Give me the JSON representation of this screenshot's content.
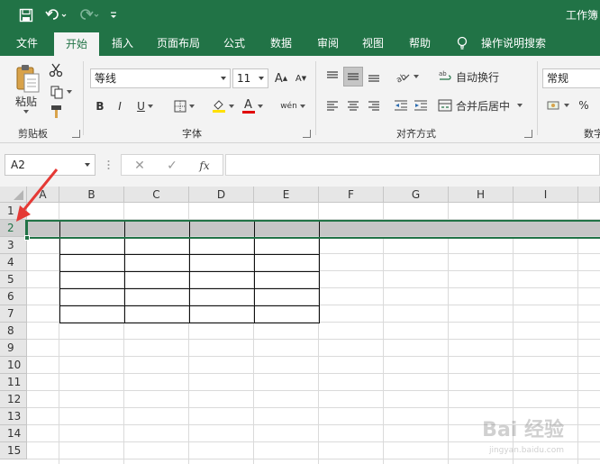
{
  "title": "工作簿",
  "tabs": [
    "文件",
    "开始",
    "插入",
    "页面布局",
    "公式",
    "数据",
    "审阅",
    "视图",
    "帮助",
    "操作说明搜索"
  ],
  "ribbon": {
    "clipboard": {
      "paste": "粘贴",
      "group": "剪贴板"
    },
    "font": {
      "name": "等线",
      "size": "11",
      "group": "字体",
      "bold": "B",
      "italic": "I",
      "underline": "U",
      "grow": "A",
      "shrink": "A",
      "font_color": "A",
      "phonetic": "wén"
    },
    "alignment": {
      "wrap": "自动换行",
      "merge": "合并后居中",
      "group": "对齐方式"
    },
    "number": {
      "format": "常规",
      "percent": "%",
      "group": "数字"
    }
  },
  "formula_bar": {
    "name_box": "A2",
    "fx": "fx",
    "value": ""
  },
  "grid": {
    "columns": [
      "A",
      "B",
      "C",
      "D",
      "E",
      "F",
      "G",
      "H",
      "I"
    ],
    "rows": [
      "1",
      "2",
      "3",
      "4",
      "5",
      "6",
      "7",
      "8",
      "9",
      "10",
      "11",
      "12",
      "13",
      "14",
      "15"
    ],
    "selected_row": "2"
  },
  "watermark": {
    "text": "Bai 经验",
    "sub": "jingyan.baidu.com"
  },
  "colors": {
    "excel_green": "#217346",
    "annotation": "#e53935"
  }
}
